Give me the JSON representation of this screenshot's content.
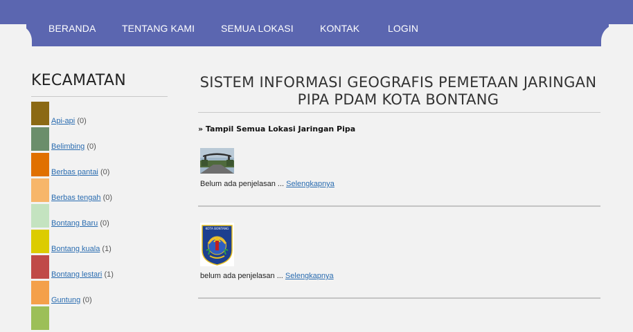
{
  "nav": {
    "items": [
      "BERANDA",
      "TENTANG KAMI",
      "SEMUA LOKASI",
      "KONTAK",
      "LOGIN"
    ]
  },
  "sidebar": {
    "title": "KECAMATAN",
    "items": [
      {
        "label": "Api-api",
        "count": "(0)",
        "color": "#8b6914"
      },
      {
        "label": "Belimbing",
        "count": "(0)",
        "color": "#6b8e6b"
      },
      {
        "label": "Berbas pantai",
        "count": "(0)",
        "color": "#e07000"
      },
      {
        "label": "Berbas tengah",
        "count": "(0)",
        "color": "#f7b66a"
      },
      {
        "label": "Bontang Baru",
        "count": "(0)",
        "color": "#c4e3c0"
      },
      {
        "label": "Bontang kuala",
        "count": "(1)",
        "color": "#dccc00"
      },
      {
        "label": "Bontang lestari",
        "count": "(1)",
        "color": "#c04a48"
      },
      {
        "label": "Guntung",
        "count": "(0)",
        "color": "#f4a04a"
      },
      {
        "label": "",
        "count": "",
        "color": "#9cbf58"
      }
    ]
  },
  "main": {
    "title_line1": "SISTEM INFORMASI GEOGRAFIS PEMETAAN JARINGAN",
    "title_line2": "PIPA PDAM KOTA BONTANG",
    "show_all": "» Tampil Semua Lokasi Jaringan Pipa",
    "locations": [
      {
        "desc": "Belum ada penjelasan ... ",
        "more": "Selengkapnya",
        "image": "road-gate-photo"
      },
      {
        "desc": "belum ada penjelasan ... ",
        "more": "Selengkapnya",
        "image": "kota-bontang-emblem"
      }
    ],
    "emblem_text": "KOTA BONTANG"
  }
}
